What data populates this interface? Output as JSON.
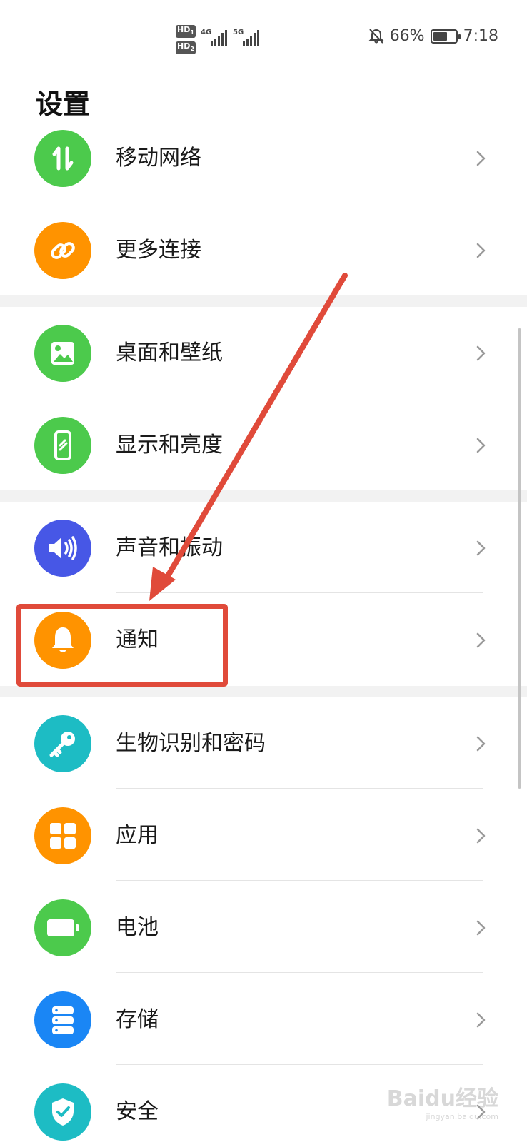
{
  "status_bar": {
    "network_a": "4G",
    "network_b": "5G",
    "battery_percent": "66%",
    "battery_level": 0.66,
    "time": "7:18"
  },
  "page_title": "设置",
  "settings_items": [
    {
      "label": "移动网络",
      "icon": "mobile-data-icon",
      "color": "#4cca4c"
    },
    {
      "label": "更多连接",
      "icon": "link-icon",
      "color": "#ff9300"
    },
    {
      "label": "桌面和壁纸",
      "icon": "wallpaper-icon",
      "color": "#4cca4c"
    },
    {
      "label": "显示和亮度",
      "icon": "phone-display-icon",
      "color": "#4cca4c"
    },
    {
      "label": "声音和振动",
      "icon": "speaker-icon",
      "color": "#4757e6"
    },
    {
      "label": "通知",
      "icon": "bell-icon",
      "color": "#ff9300"
    },
    {
      "label": "生物识别和密码",
      "icon": "key-icon",
      "color": "#1dbcc4"
    },
    {
      "label": "应用",
      "icon": "apps-grid-icon",
      "color": "#ff9300"
    },
    {
      "label": "电池",
      "icon": "battery-icon",
      "color": "#4cca4c"
    },
    {
      "label": "存储",
      "icon": "storage-icon",
      "color": "#1a86f5"
    },
    {
      "label": "安全",
      "icon": "shield-icon",
      "color": "#1dbcc4"
    }
  ],
  "annotation": {
    "color": "#e04a3a"
  },
  "watermark": {
    "brand": "Baidu经验",
    "url": "jingyan.baidu.com"
  }
}
